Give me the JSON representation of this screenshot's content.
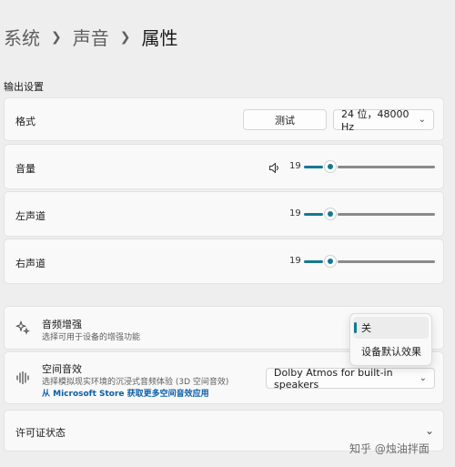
{
  "breadcrumb": {
    "items": [
      "系统",
      "声音",
      "属性"
    ]
  },
  "output_section": {
    "title": "输出设置"
  },
  "format_row": {
    "label": "格式",
    "test_button": "测试",
    "format_value": "24 位，48000 Hz"
  },
  "volume_row": {
    "label": "音量",
    "value": "19",
    "level": 0.19
  },
  "left_row": {
    "label": "左声道",
    "value": "19",
    "level": 0.19
  },
  "right_row": {
    "label": "右声道",
    "value": "19",
    "level": 0.19
  },
  "enhance_row": {
    "title": "音频增强",
    "subtitle": "选择可用于设备的增强功能"
  },
  "enhance_menu": {
    "items": [
      "关",
      "设备默认效果"
    ],
    "selected": "关"
  },
  "spatial_row": {
    "title": "空间音效",
    "subtitle": "选择模拟现实环境的沉浸式音频体验 (3D 空间音效)",
    "link": "从 Microsoft Store 获取更多空间音效应用",
    "value": "Dolby Atmos for built-in speakers"
  },
  "license_row": {
    "label": "许可证状态"
  },
  "watermark": {
    "text": "知乎 @烛油拌面"
  },
  "colors": {
    "accent": "#137a91",
    "link": "#0a5ea8"
  }
}
